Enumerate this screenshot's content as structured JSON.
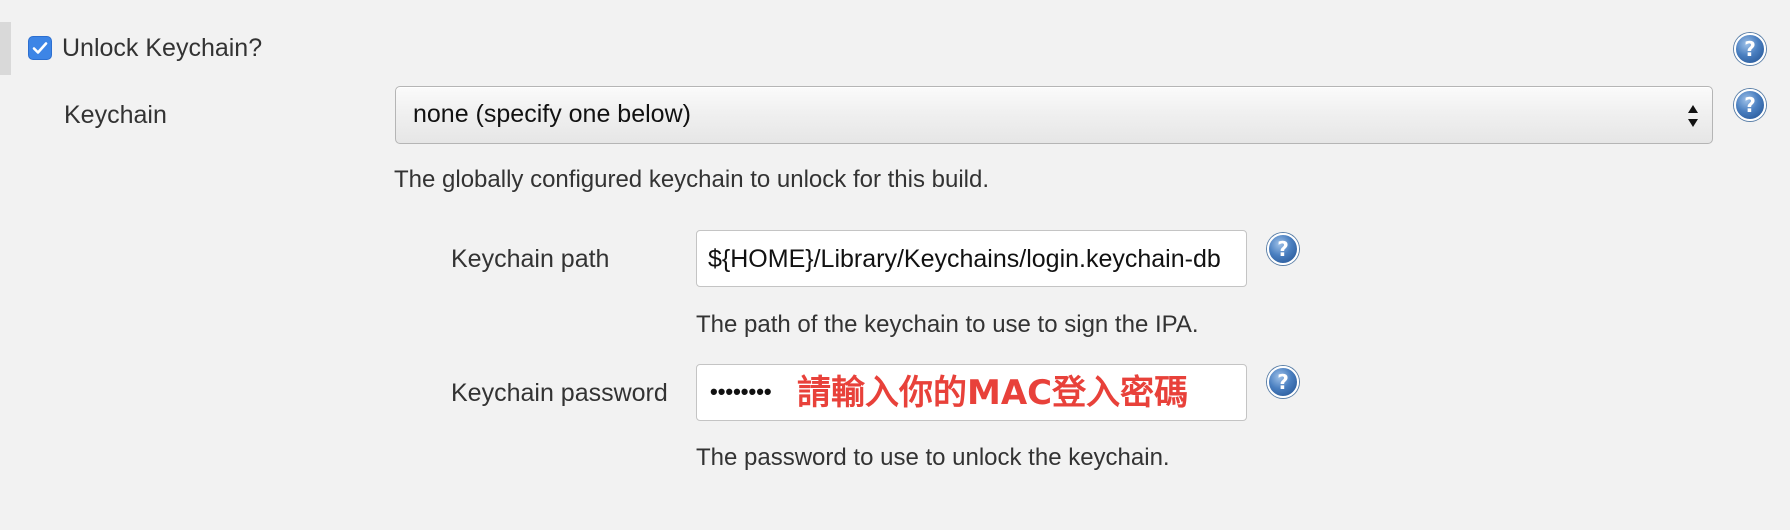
{
  "section": {
    "checkbox_checked": true,
    "title": "Unlock Keychain?",
    "help_glyph": "?"
  },
  "keychain": {
    "label": "Keychain",
    "selected": "none (specify one below)",
    "description": "The globally configured keychain to unlock for this build."
  },
  "keychain_path": {
    "label": "Keychain path",
    "value": "${HOME}/Library/Keychains/login.keychain-db",
    "description": "The path of the keychain to use to sign the IPA."
  },
  "keychain_password": {
    "label": "Keychain password",
    "masked_value": "••••••••",
    "annotation": "請輸入你的MAC登入密碼",
    "description": "The password to use to unlock the keychain."
  },
  "icons": {
    "help": "help-icon",
    "checkmark": "checkmark-icon",
    "select_arrows": "select-arrows-icon"
  },
  "colors": {
    "background": "#f2f2f2",
    "checkbox_accent": "#3d85e6",
    "help_icon": "#2f63a8",
    "annotation_red": "#e8413a"
  }
}
